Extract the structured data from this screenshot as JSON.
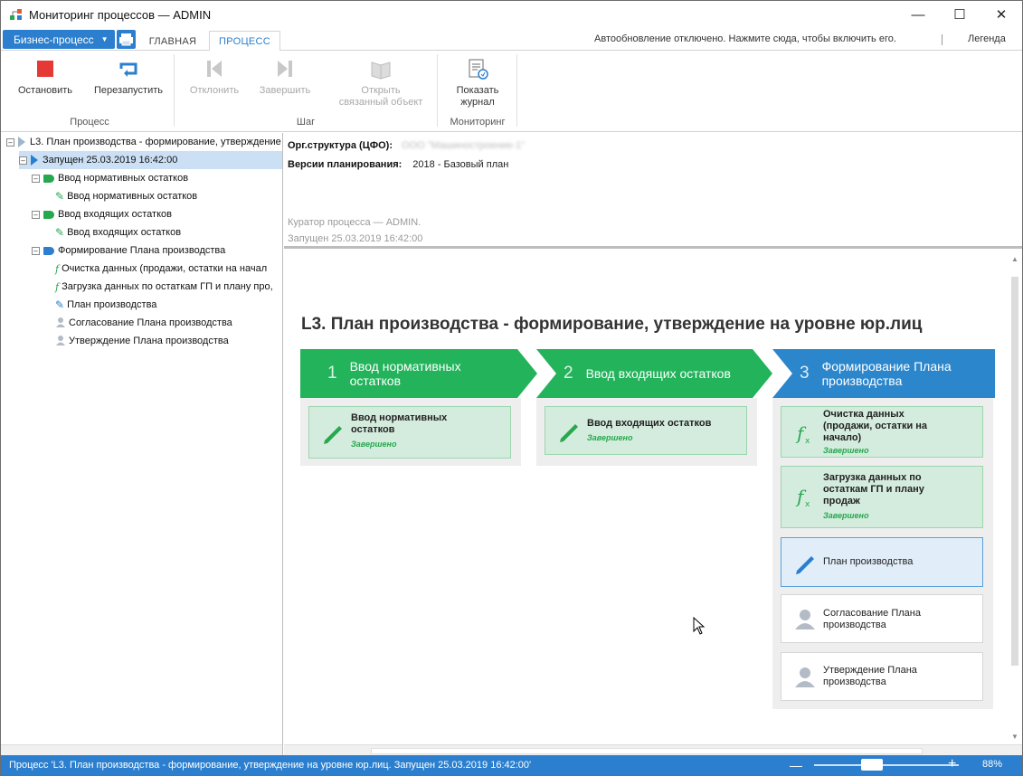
{
  "window": {
    "title": "Мониторинг процессов — ADMIN"
  },
  "tabs": {
    "biz_button": "Бизнес-процесс",
    "main": "ГЛАВНАЯ",
    "process": "ПРОЦЕСС",
    "autoupdate": "Автообновление отключено. Нажмите сюда, чтобы включить его.",
    "legend": "Легенда"
  },
  "ribbon": {
    "stop": "Остановить",
    "restart": "Перезапустить",
    "reject": "Отклонить",
    "finish": "Завершить",
    "open_obj": "Открыть\nсвязанный объект",
    "show_log": "Показать\nжурнал",
    "group_process": "Процесс",
    "group_step": "Шаг",
    "group_monitoring": "Мониторинг"
  },
  "tree": {
    "root": "L3. План производства - формирование, утверждение н",
    "launch": "Запущен 25.03.2019 16:42:00",
    "items": [
      "Ввод нормативных остатков",
      "Ввод нормативных остатков",
      "Ввод входящих остатков",
      "Ввод входящих остатков",
      "Формирование Плана производства",
      "Очистка данных (продажи, остатки на начал",
      "Загрузка данных по остаткам ГП и плану про,",
      "План производства",
      "Согласование Плана производства",
      "Утверждение Плана производства"
    ]
  },
  "info": {
    "org_label": "Орг.структура (ЦФО):",
    "org_value": "ООО \"Машиностроение-1\"",
    "ver_label": "Версии планирования:",
    "ver_value": "2018 - Базовый план",
    "curator": "Куратор процесса — ADMIN.",
    "launched": "Запущен 25.03.2019 16:42:00"
  },
  "process": {
    "title": "L3. План производства - формирование, утверждение на уровне юр.лиц",
    "stages": [
      {
        "num": "1",
        "label": "Ввод нормативных\nостатков",
        "color": "#22b35b"
      },
      {
        "num": "2",
        "label": "Ввод входящих остатков",
        "color": "#22b35b"
      },
      {
        "num": "3",
        "label": "Формирование Плана\nпроизводства",
        "color": "#2b86cc"
      }
    ],
    "cards": [
      {
        "text": "Ввод нормативных\nостатков",
        "status": "Завершено"
      },
      {
        "text": "Ввод входящих остатков",
        "status": "Завершено"
      },
      {
        "text": "Очистка данных\n(продажи, остатки на\nначало)",
        "status": "Завершено"
      },
      {
        "text": "Загрузка данных по\nостаткам ГП и плану\nпродаж",
        "status": "Завершено"
      },
      {
        "text": "План производства",
        "status": ""
      },
      {
        "text": "Согласование Плана\nпроизводства",
        "status": ""
      },
      {
        "text": "Утверждение Плана\nпроизводства",
        "status": ""
      }
    ]
  },
  "status": {
    "text": "Процесс 'L3. План производства - формирование, утверждение на уровне юр.лиц. Запущен 25.03.2019 16:42:00'",
    "zoom": "88%",
    "zoom_level": 0.38
  },
  "colors": {
    "accent": "#2b7fce",
    "green": "#22b35b",
    "done_card": "#d4ecdd"
  }
}
